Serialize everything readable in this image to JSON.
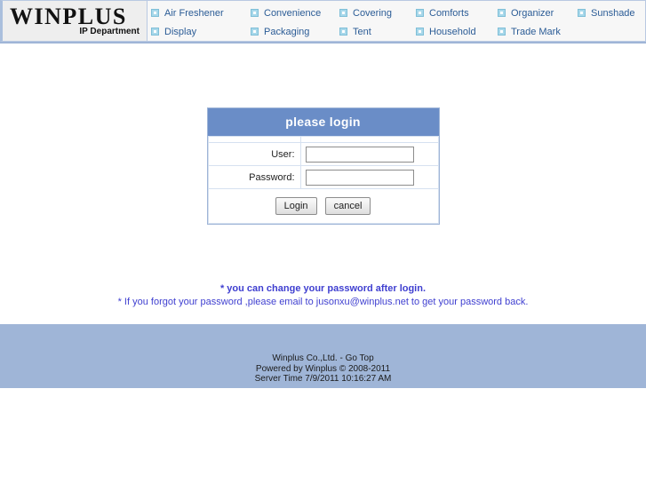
{
  "brand": {
    "name": "WINPLUS",
    "department": "IP Department"
  },
  "nav": {
    "items": [
      {
        "label": "Air Freshener",
        "icon": "menu-square-icon"
      },
      {
        "label": "Convenience",
        "icon": "menu-square-icon"
      },
      {
        "label": "Covering",
        "icon": "menu-square-icon"
      },
      {
        "label": "Comforts",
        "icon": "menu-square-icon"
      },
      {
        "label": "Organizer",
        "icon": "menu-square-icon"
      },
      {
        "label": "Sunshade",
        "icon": "menu-square-icon"
      },
      {
        "label": "Display",
        "icon": "menu-square-icon"
      },
      {
        "label": "Packaging",
        "icon": "menu-square-icon"
      },
      {
        "label": "Tent",
        "icon": "menu-square-icon"
      },
      {
        "label": "Household",
        "icon": "menu-square-icon"
      },
      {
        "label": "Trade Mark",
        "icon": "menu-square-icon"
      }
    ]
  },
  "login": {
    "title": "please login",
    "user_label": "User:",
    "user_value": "",
    "password_label": "Password:",
    "password_value": "",
    "submit_label": "Login",
    "cancel_label": "cancel"
  },
  "notes": {
    "line1": "* you can change your password after login.",
    "line2": "* If you forgot your password ,please email to jusonxu@winplus.net to get your password back."
  },
  "footer": {
    "company": "Winplus Co.,Ltd. - Go Top",
    "powered": "Powered by Winplus © 2008-2011",
    "server_time": "Server Time 7/9/2011 10:16:27 AM"
  },
  "colors": {
    "nav_link": "#2b5c96",
    "login_header": "#6a8dc7",
    "footer_bg": "#9fb5d7",
    "note_text": "#3f3fd0",
    "icon_blue": "#a8d8ea"
  }
}
